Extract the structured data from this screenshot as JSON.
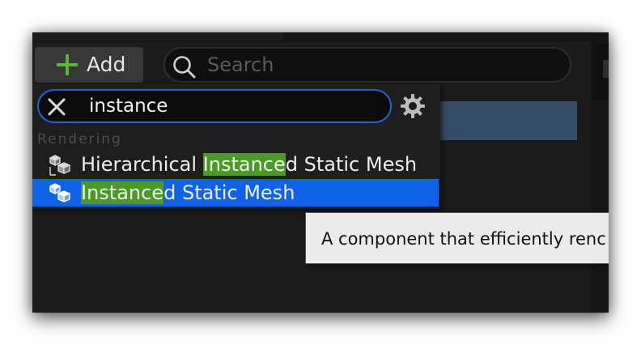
{
  "toolbar": {
    "add_label": "Add",
    "add_icon": "plus-icon",
    "accent_color": "#5cb531"
  },
  "search": {
    "placeholder": "Search",
    "icon": "search-icon"
  },
  "component_picker": {
    "filter_value": "instance",
    "clear_icon": "close-icon",
    "settings_icon": "gear-icon",
    "focus_color": "#1f65d6",
    "category": "Rendering",
    "results": [
      {
        "icon": "instanced-mesh-icon",
        "prefix": "Hierarchical ",
        "match": "Instance",
        "suffix": "d Static Mesh",
        "selected": false
      },
      {
        "icon": "instanced-mesh-icon",
        "prefix": "",
        "match": "Instance",
        "suffix": "d Static Mesh",
        "selected": true
      }
    ],
    "highlight_color": "#4b9a25",
    "selected_color": "#0f63e7"
  },
  "tooltip": {
    "text": "A component that efficiently renc"
  }
}
